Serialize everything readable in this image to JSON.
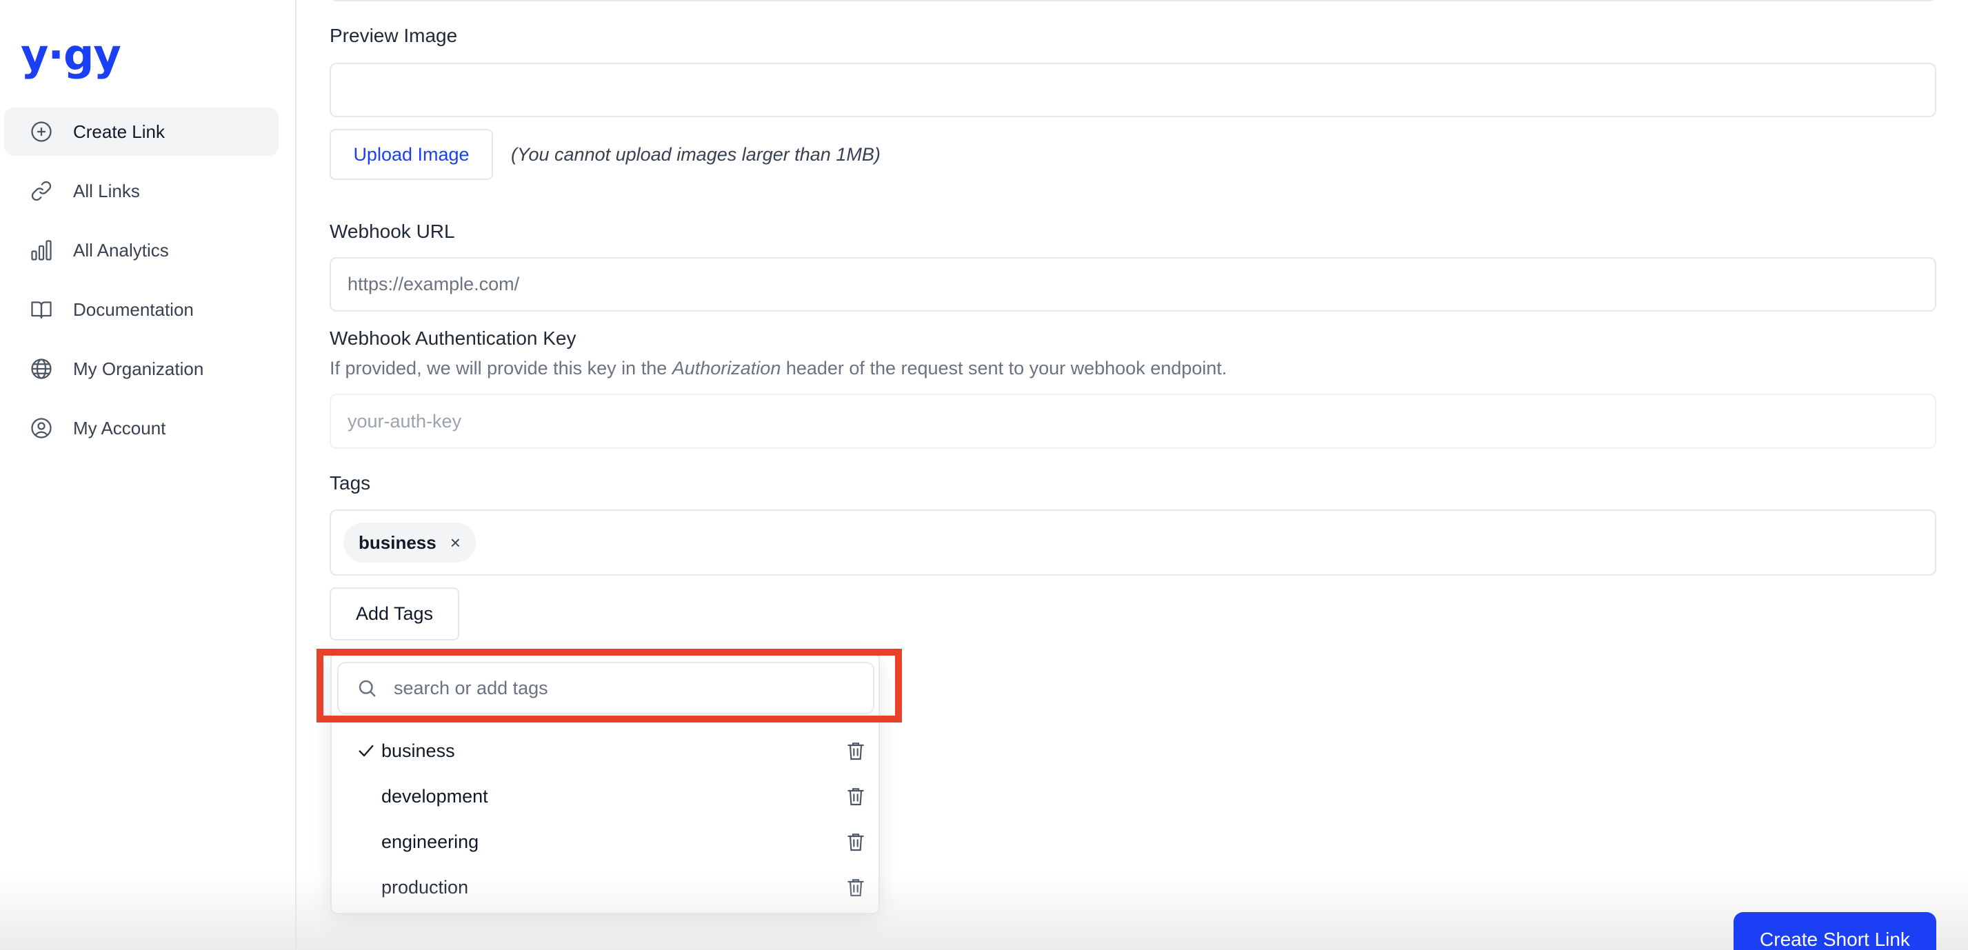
{
  "app": {
    "logo": "y·gy",
    "brand_color": "#1a3ff5",
    "highlight_color": "#e8412a"
  },
  "sidebar": {
    "items": [
      {
        "label": "Create Link",
        "icon": "plus-circle-icon",
        "active": true
      },
      {
        "label": "All Links",
        "icon": "link-icon",
        "active": false
      },
      {
        "label": "All Analytics",
        "icon": "bar-chart-icon",
        "active": false
      },
      {
        "label": "Documentation",
        "icon": "book-open-icon",
        "active": false
      },
      {
        "label": "My Organization",
        "icon": "globe-icon",
        "active": false
      },
      {
        "label": "My Account",
        "icon": "user-circle-icon",
        "active": false
      }
    ]
  },
  "form": {
    "preview_image": {
      "label": "Preview Image",
      "value": "",
      "upload_button": "Upload Image",
      "hint": "(You cannot upload images larger than 1MB)"
    },
    "webhook_url": {
      "label": "Webhook URL",
      "value": "https://example.com/"
    },
    "webhook_auth": {
      "label": "Webhook Authentication Key",
      "help_before": "If provided, we will provide this key in the ",
      "help_em": "Authorization",
      "help_after": " header of the request sent to your webhook endpoint.",
      "placeholder": "your-auth-key"
    },
    "tags": {
      "label": "Tags",
      "selected": [
        "business"
      ],
      "add_button": "Add Tags",
      "remove_symbol": "×"
    },
    "submit_button": "Create Short Link"
  },
  "tag_dropdown": {
    "search_placeholder": "search or add tags",
    "options": [
      {
        "label": "business",
        "checked": true
      },
      {
        "label": "development",
        "checked": false
      },
      {
        "label": "engineering",
        "checked": false
      },
      {
        "label": "production",
        "checked": false
      }
    ]
  }
}
